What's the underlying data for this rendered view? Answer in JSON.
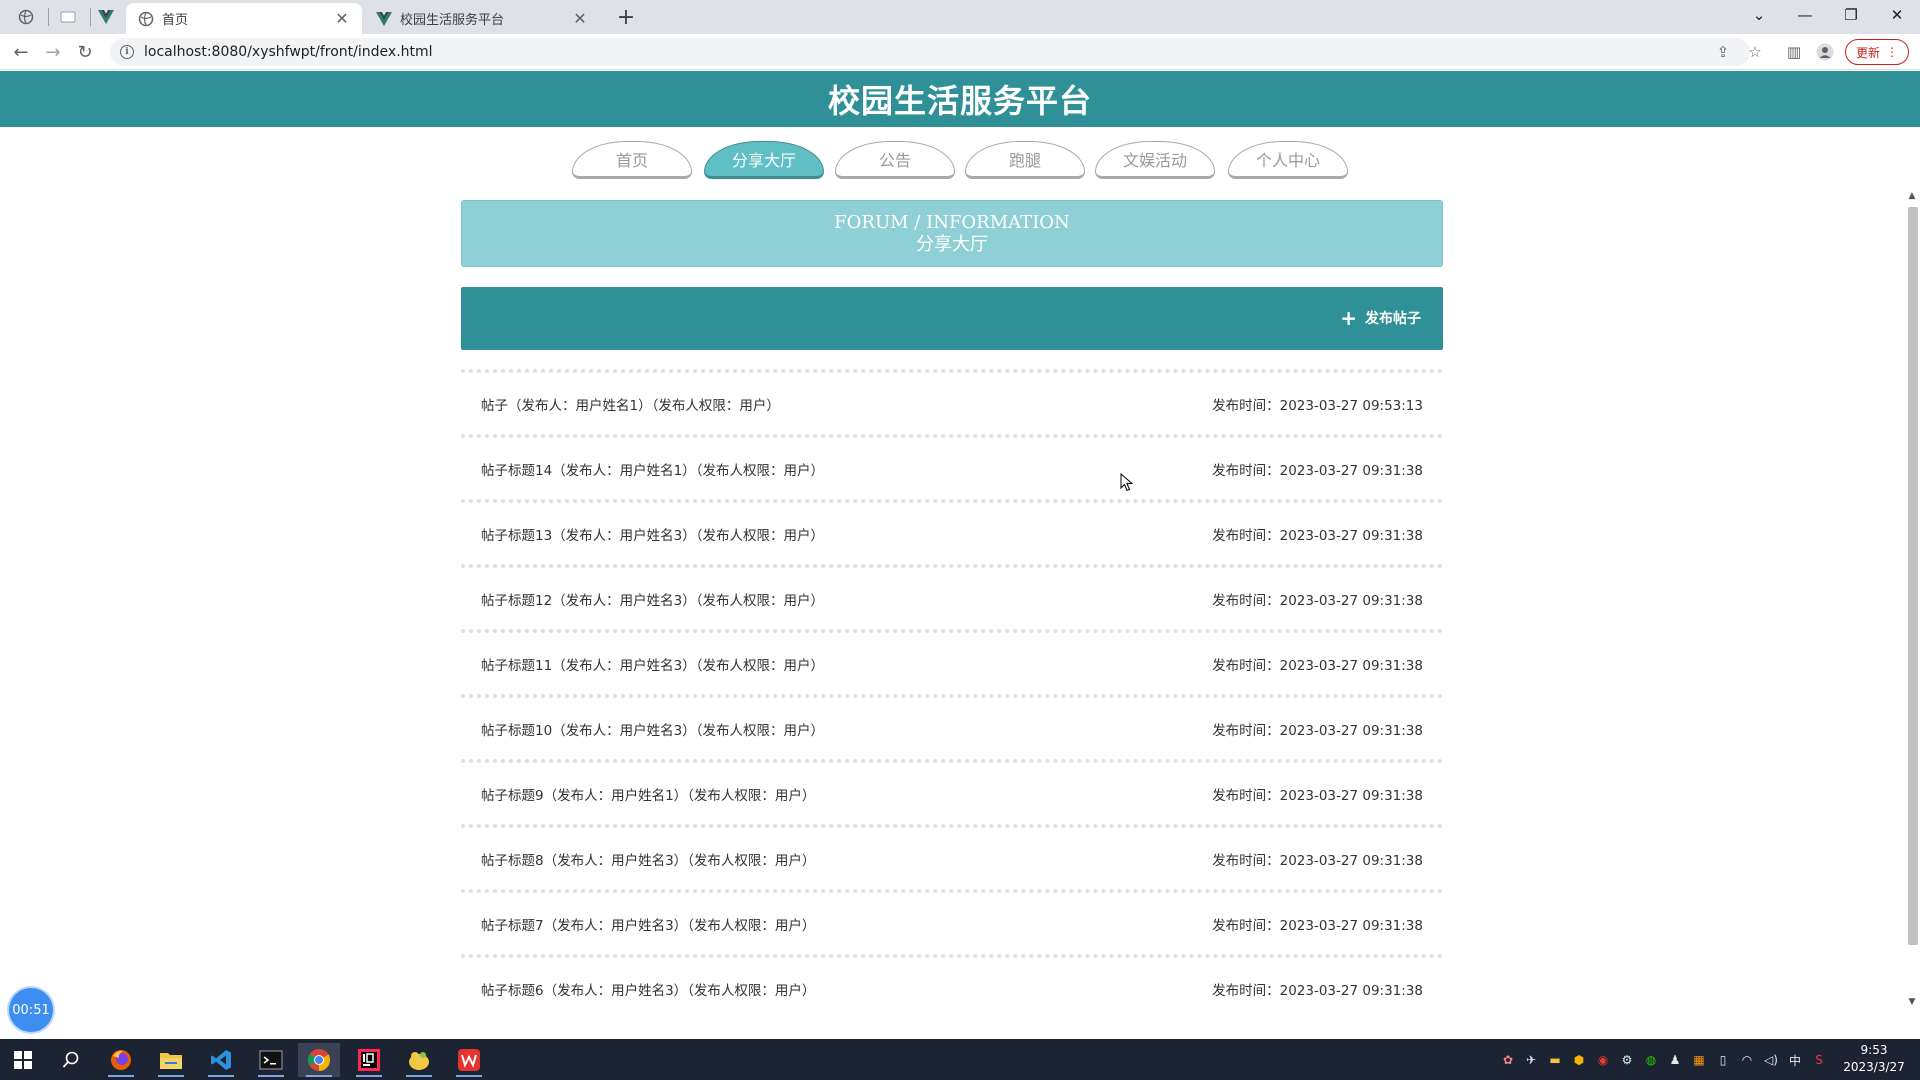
{
  "browser": {
    "tabs": [
      {
        "title": "首页",
        "active": true
      },
      {
        "title": "校园生活服务平台",
        "active": false
      }
    ],
    "url": "localhost:8080/xyshfwpt/front/index.html",
    "update_label": "更新"
  },
  "site": {
    "title": "校园生活服务平台",
    "nav": [
      {
        "label": "首页",
        "active": false
      },
      {
        "label": "分享大厅",
        "active": true
      },
      {
        "label": "公告",
        "active": false
      },
      {
        "label": "跑腿",
        "active": false
      },
      {
        "label": "文娱活动",
        "active": false
      },
      {
        "label": "个人中心",
        "active": false
      }
    ],
    "banner": {
      "en": "FORUM / INFORMATION",
      "cn": "分享大厅"
    },
    "publish_label": "发布帖子",
    "posts": [
      {
        "title": "帖子（发布人：用户姓名1）（发布人权限：用户）",
        "time": "发布时间：2023-03-27 09:53:13"
      },
      {
        "title": "帖子标题14（发布人：用户姓名1）（发布人权限：用户）",
        "time": "发布时间：2023-03-27 09:31:38"
      },
      {
        "title": "帖子标题13（发布人：用户姓名3）（发布人权限：用户）",
        "time": "发布时间：2023-03-27 09:31:38"
      },
      {
        "title": "帖子标题12（发布人：用户姓名3）（发布人权限：用户）",
        "time": "发布时间：2023-03-27 09:31:38"
      },
      {
        "title": "帖子标题11（发布人：用户姓名3）（发布人权限：用户）",
        "time": "发布时间：2023-03-27 09:31:38"
      },
      {
        "title": "帖子标题10（发布人：用户姓名3）（发布人权限：用户）",
        "time": "发布时间：2023-03-27 09:31:38"
      },
      {
        "title": "帖子标题9（发布人：用户姓名1）（发布人权限：用户）",
        "time": "发布时间：2023-03-27 09:31:38"
      },
      {
        "title": "帖子标题8（发布人：用户姓名3）（发布人权限：用户）",
        "time": "发布时间：2023-03-27 09:31:38"
      },
      {
        "title": "帖子标题7（发布人：用户姓名3）（发布人权限：用户）",
        "time": "发布时间：2023-03-27 09:31:38"
      },
      {
        "title": "帖子标题6（发布人：用户姓名3）（发布人权限：用户）",
        "time": "发布时间：2023-03-27 09:31:38"
      }
    ],
    "timer": "00:51"
  },
  "taskbar": {
    "time": "9:53",
    "date": "2023/3/27",
    "ime": "中"
  },
  "colors": {
    "primary": "#2f9197",
    "nav_active": "#5fbfc4",
    "banner": "#8fd0d6"
  }
}
